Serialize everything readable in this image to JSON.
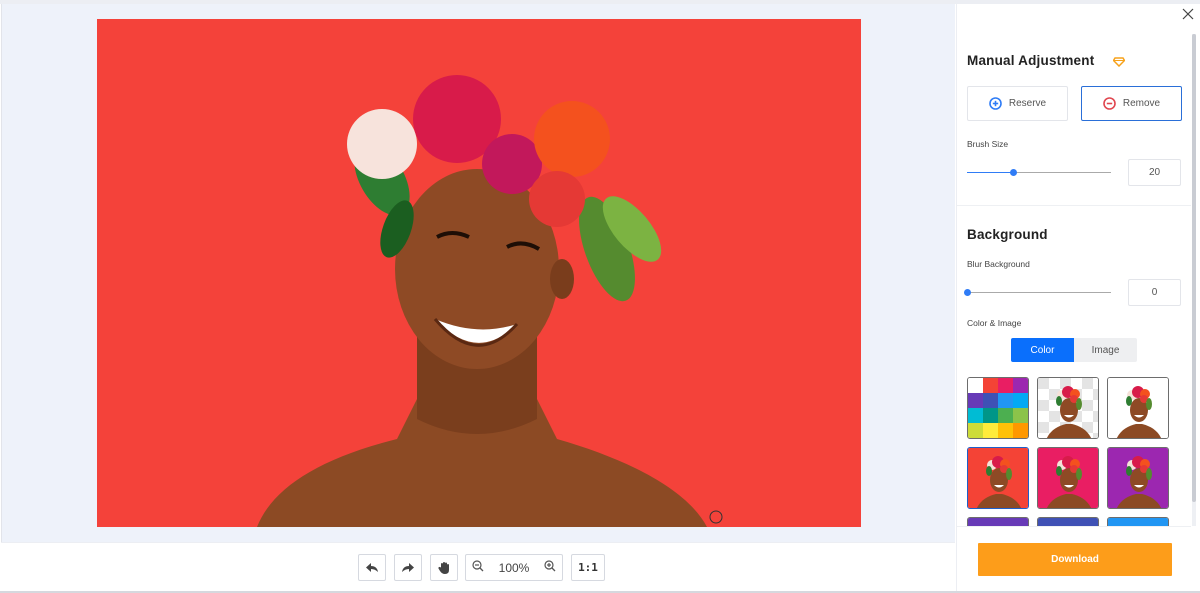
{
  "canvas": {
    "background_color": "#f4423a",
    "image_description": "smiling woman wearing a flower crown"
  },
  "toolbar": {
    "undo_icon": "undo-icon",
    "redo_icon": "redo-icon",
    "pan_icon": "hand-icon",
    "zoom_out_icon": "zoom-out-icon",
    "zoom_level": "100%",
    "zoom_in_icon": "zoom-in-icon",
    "actual_size_label": "1:1"
  },
  "panel": {
    "close_icon": "close-icon",
    "manual": {
      "title": "Manual Adjustment",
      "premium_icon": "diamond-icon",
      "reserve_label": "Reserve",
      "remove_label": "Remove",
      "active_mode": "Remove",
      "brush_label": "Brush Size",
      "brush_value": "20",
      "brush_fraction": 0.32
    },
    "background": {
      "title": "Background",
      "blur_label": "Blur Background",
      "blur_value": "0",
      "blur_fraction": 0.0,
      "color_image_label": "Color & Image",
      "tabs": [
        {
          "label": "Color",
          "active": true
        },
        {
          "label": "Image",
          "active": false
        }
      ],
      "palette_colors": [
        "#ffffff",
        "#f44336",
        "#e91e63",
        "#9c27b0",
        "#673ab7",
        "#3f51b5",
        "#2196f3",
        "#03a9f4",
        "#00bcd4",
        "#009688",
        "#4caf50",
        "#8bc34a",
        "#cddc39",
        "#ffeb3b",
        "#ffc107",
        "#ff9800"
      ],
      "presets": [
        {
          "name": "palette",
          "bg": "palette"
        },
        {
          "name": "transparent",
          "bg": "transparent"
        },
        {
          "name": "white",
          "bg": "#ffffff"
        },
        {
          "name": "red",
          "bg": "#f44336",
          "selected": true
        },
        {
          "name": "pink",
          "bg": "#e91e63"
        },
        {
          "name": "purple",
          "bg": "#9c27b0"
        },
        {
          "name": "deep-purple",
          "bg": "#673ab7"
        },
        {
          "name": "indigo",
          "bg": "#3f51b5"
        },
        {
          "name": "blue",
          "bg": "#2196f3"
        }
      ]
    },
    "download_label": "Download",
    "colors": {
      "accent_blue": "#0a6ffc",
      "download_orange": "#fd9d1a",
      "reserve_icon": "#2f7cf6",
      "remove_icon": "#e0464f",
      "premium_icon": "#f7a21b"
    }
  }
}
